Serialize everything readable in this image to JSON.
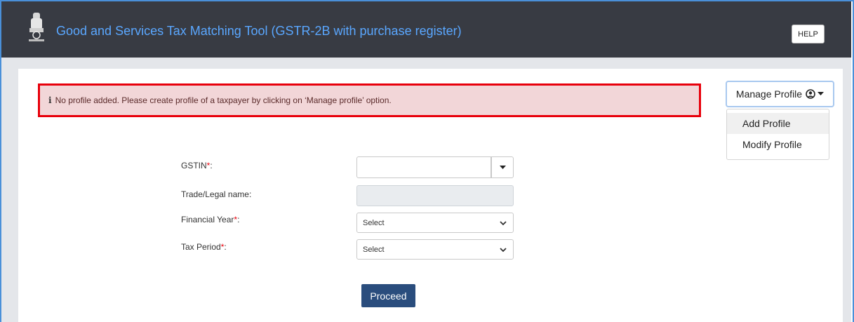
{
  "header": {
    "title": "Good and Services Tax Matching Tool (GSTR-2B with purchase register)",
    "help_label": "HELP",
    "emblem_icon": "national-emblem-icon"
  },
  "alert": {
    "icon": "info-icon",
    "icon_glyph": "i",
    "message": "No profile added. Please create profile of a taxpayer by clicking on ‘Manage profile’ option."
  },
  "profile_menu": {
    "button_label": "Manage Profile",
    "items": [
      {
        "label": "Add Profile"
      },
      {
        "label": "Modify Profile"
      }
    ]
  },
  "form": {
    "gstin": {
      "label": "GSTIN",
      "required_mark": "*",
      "suffix": ":",
      "value": ""
    },
    "trade_name": {
      "label": "Trade/Legal name:",
      "value": ""
    },
    "financial_year": {
      "label": "Financial Year",
      "required_mark": "*",
      "suffix": ":",
      "selected": "Select"
    },
    "tax_period": {
      "label": "Tax Period",
      "required_mark": "*",
      "suffix": ":",
      "selected": "Select"
    },
    "proceed_label": "Proceed"
  },
  "colors": {
    "header_bg": "#383b43",
    "title": "#5aa7ff",
    "alert_bg": "#f2d6d8",
    "alert_border": "#e8000b",
    "primary_button": "#2a4d7d"
  }
}
